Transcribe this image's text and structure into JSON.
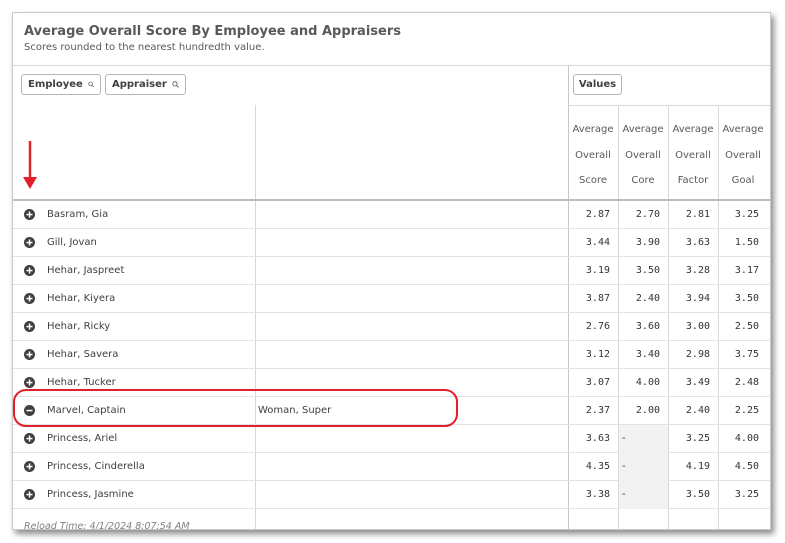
{
  "title": "Average Overall Score By Employee and Appraisers",
  "subtitle": "Scores rounded to the nearest hundredth value.",
  "filters": [
    {
      "label": "Employee",
      "icon": "search-icon"
    },
    {
      "label": "Appraiser",
      "icon": "search-icon"
    }
  ],
  "values_button": "Values",
  "columns": [
    {
      "lines": [
        "Average",
        "Overall",
        "Score"
      ]
    },
    {
      "lines": [
        "Average",
        "Overall",
        "Core"
      ]
    },
    {
      "lines": [
        "Average",
        "Overall",
        "Factor"
      ]
    },
    {
      "lines": [
        "Average",
        "Overall",
        "Goal"
      ]
    }
  ],
  "rows": [
    {
      "name": "Basram, Gia",
      "appraiser": "",
      "expanded": false,
      "values": [
        "2.87",
        "2.70",
        "2.81",
        "3.25"
      ]
    },
    {
      "name": "Gill, Jovan",
      "appraiser": "",
      "expanded": false,
      "values": [
        "3.44",
        "3.90",
        "3.63",
        "1.50"
      ]
    },
    {
      "name": "Hehar, Jaspreet",
      "appraiser": "",
      "expanded": false,
      "values": [
        "3.19",
        "3.50",
        "3.28",
        "3.17"
      ]
    },
    {
      "name": "Hehar, Kiyera",
      "appraiser": "",
      "expanded": false,
      "values": [
        "3.87",
        "2.40",
        "3.94",
        "3.50"
      ]
    },
    {
      "name": "Hehar, Ricky",
      "appraiser": "",
      "expanded": false,
      "values": [
        "2.76",
        "3.60",
        "3.00",
        "2.50"
      ]
    },
    {
      "name": "Hehar, Savera",
      "appraiser": "",
      "expanded": false,
      "values": [
        "3.12",
        "3.40",
        "2.98",
        "3.75"
      ]
    },
    {
      "name": "Hehar, Tucker",
      "appraiser": "",
      "expanded": false,
      "values": [
        "3.07",
        "4.00",
        "3.49",
        "2.48"
      ]
    },
    {
      "name": "Marvel, Captain",
      "appraiser": "Woman, Super",
      "expanded": true,
      "values": [
        "2.37",
        "2.00",
        "2.40",
        "2.25"
      ]
    },
    {
      "name": "Princess, Ariel",
      "appraiser": "",
      "expanded": false,
      "values": [
        "3.63",
        "-",
        "3.25",
        "4.00"
      ]
    },
    {
      "name": "Princess, Cinderella",
      "appraiser": "",
      "expanded": false,
      "values": [
        "4.35",
        "-",
        "4.19",
        "4.50"
      ]
    },
    {
      "name": "Princess, Jasmine",
      "appraiser": "",
      "expanded": false,
      "values": [
        "3.38",
        "-",
        "3.50",
        "3.25"
      ]
    }
  ],
  "reload_time": "Reload Time: 4/1/2024 8:07:54 AM",
  "annotation_color": "#e0202a"
}
